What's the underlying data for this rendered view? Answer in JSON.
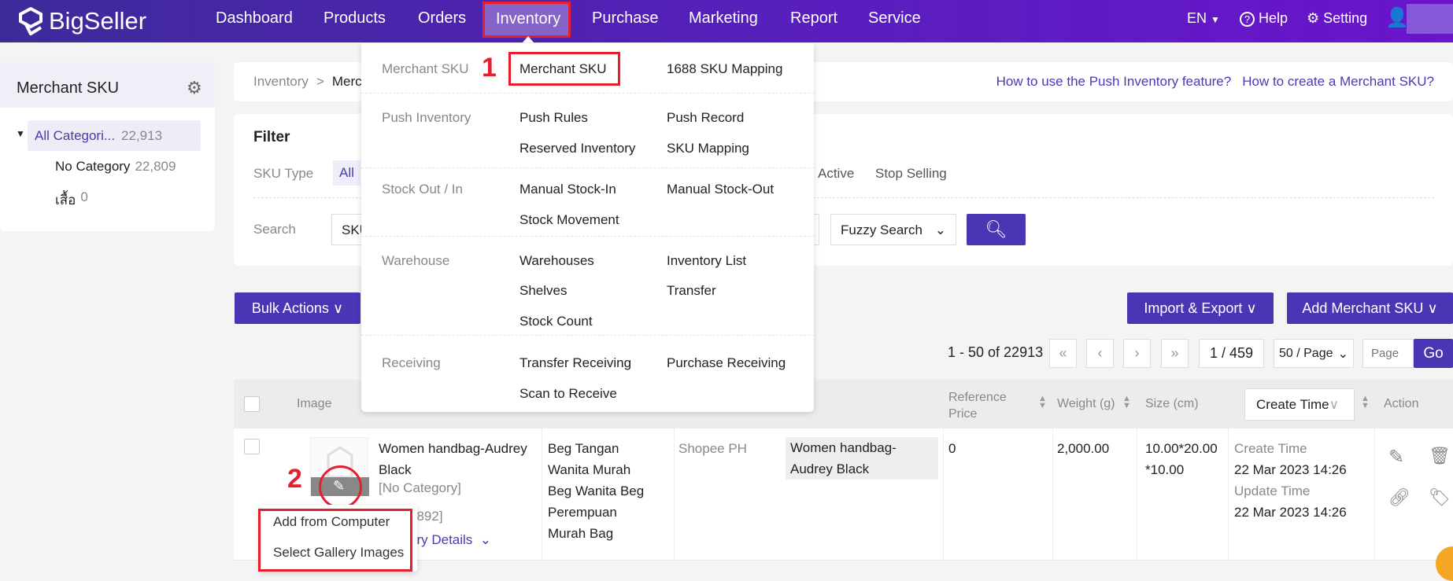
{
  "app": {
    "logo": "BigSeller"
  },
  "nav": {
    "items": [
      "Dashboard",
      "Products",
      "Orders",
      "Inventory",
      "Purchase",
      "Marketing",
      "Report",
      "Service"
    ],
    "active": "Inventory",
    "lang": "EN",
    "help": "Help",
    "setting": "Setting"
  },
  "sidebar": {
    "title": "Merchant SKU",
    "categories": [
      {
        "label": "All Categori...",
        "count": "22,913"
      },
      {
        "label": "No Category",
        "count": "22,809"
      },
      {
        "label": "เสื้อ",
        "count": "0"
      }
    ]
  },
  "breadcrumb": {
    "root": "Inventory",
    "sep": ">",
    "current": "Merc"
  },
  "help_links": [
    "How to use the Push Inventory feature?",
    "How to create a Merchant SKU?"
  ],
  "filter": {
    "title": "Filter",
    "sku_type_label": "SKU Type",
    "sku_type_selected": "All",
    "status_options": [
      "Active",
      "Stop Selling"
    ],
    "search_label": "Search",
    "search_field": "SKU",
    "search_mode": "Fuzzy Search"
  },
  "toolbar": {
    "bulk": "Bulk Actions",
    "import_export": "Import & Export",
    "add_sku": "Add Merchant SKU"
  },
  "pagination": {
    "range": "1 - 50 of 22913",
    "page": "1 / 459",
    "per_page": "50 / Page",
    "page_placeholder": "Page",
    "go": "Go"
  },
  "table": {
    "headers": {
      "image": "Image",
      "ref_price": "Reference Price",
      "weight": "Weight (g)",
      "size": "Size (cm)",
      "create_time": "Create Time",
      "action": "Action"
    },
    "rows": [
      {
        "name": "Women handbag-Audrey Black",
        "category": "[No Category]",
        "sku_id": "1892]",
        "details": "ory Details",
        "title": "Beg Tangan Wanita Murah Beg Wanita Beg Perempuan Murah Bag",
        "store": "Shopee PH",
        "mapped_name": "Women handbag-Audrey Black",
        "ref_price": "0",
        "weight": "2,000.00",
        "size": "10.00*20.00 *10.00",
        "create_label": "Create Time",
        "create_time": "22 Mar 2023 14:26",
        "update_label": "Update Time",
        "update_time": "22 Mar 2023 14:26"
      }
    ]
  },
  "menu": {
    "groups": [
      {
        "label": "Merchant SKU",
        "items": [
          "Merchant SKU",
          "1688 SKU Mapping"
        ]
      },
      {
        "label": "Push Inventory",
        "items": [
          "Push Rules",
          "Push Record",
          "Reserved Inventory",
          "SKU Mapping"
        ]
      },
      {
        "label": "Stock Out / In",
        "items": [
          "Manual Stock-In",
          "Manual Stock-Out",
          "Stock Movement"
        ]
      },
      {
        "label": "Warehouse",
        "items": [
          "Warehouses",
          "Inventory List",
          "Shelves",
          "Transfer",
          "Stock Count"
        ]
      },
      {
        "label": "Receiving",
        "items": [
          "Transfer Receiving",
          "Purchase Receiving",
          "Scan to Receive"
        ]
      }
    ]
  },
  "image_menu": [
    "Add from Computer",
    "Select Gallery Images"
  ],
  "annotations": [
    "1",
    "2"
  ],
  "colors": {
    "accent": "#4a36b5",
    "highlight": "#e5202e"
  }
}
